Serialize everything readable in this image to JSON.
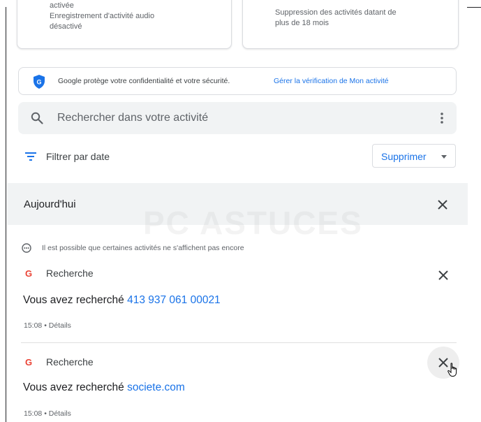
{
  "cards": {
    "left_lines": [
      "activée",
      "Enregistrement d'activité audio",
      "désactivé"
    ],
    "right_lines": [
      "Suppression des activités datant de",
      "plus de 18 mois"
    ]
  },
  "banner": {
    "text": "Google protège votre confidentialité et votre sécurité.",
    "link": "Gérer la vérification de Mon activité",
    "shield_icon": "shield-icon",
    "shield_color": "#1a73e8"
  },
  "search": {
    "placeholder": "Rechercher dans votre activité",
    "search_icon": "search-icon",
    "more_icon": "more-vert-icon"
  },
  "filter": {
    "label": "Filtrer par date",
    "icon": "filter-icon"
  },
  "delete_button": {
    "label": "Supprimer"
  },
  "day": {
    "title": "Aujourd'hui"
  },
  "notice": {
    "text": "Il est possible que certaines activités ne s'affichent pas encore"
  },
  "watermark": "PC ASTUCES",
  "items": [
    {
      "icon": "G",
      "type": "Recherche",
      "prefix": "Vous avez recherché",
      "query": "413 937 061 00021",
      "meta": "15:08 • Détails"
    },
    {
      "icon": "G",
      "type": "Recherche",
      "prefix": "Vous avez recherché",
      "query": "societe.com",
      "meta": "15:08 • Détails"
    }
  ],
  "colors": {
    "accent": "#1a73e8",
    "google_red": "#ea4335"
  }
}
